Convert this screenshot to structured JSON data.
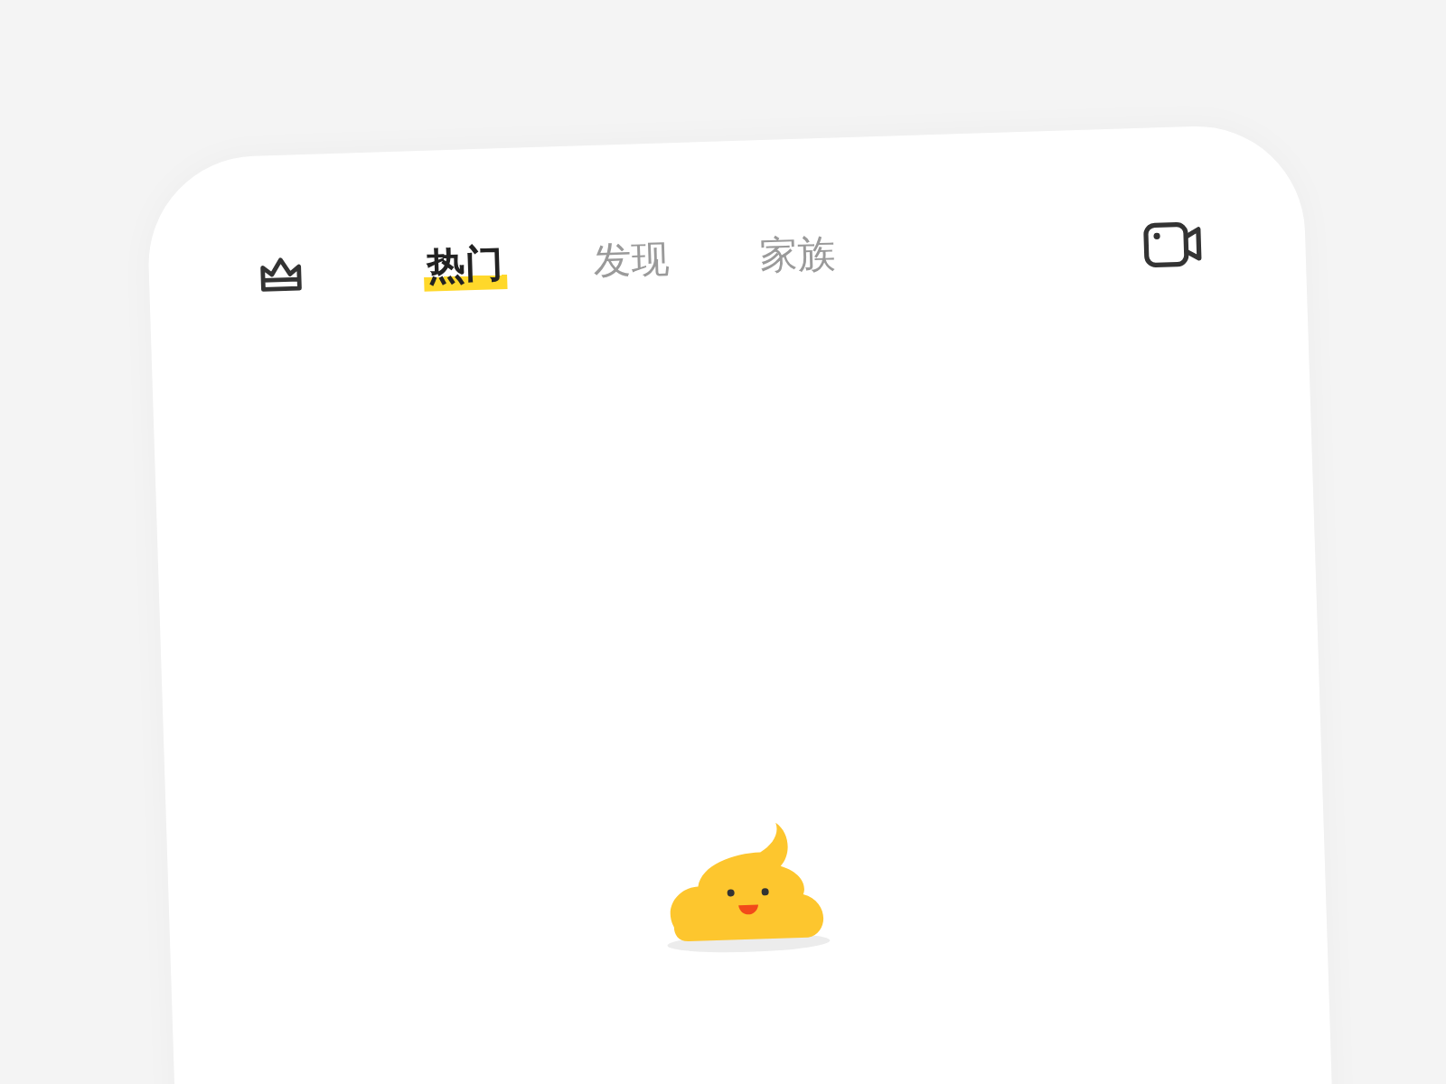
{
  "tabs": [
    {
      "label": "热门",
      "selected": true
    },
    {
      "label": "发现",
      "selected": false
    },
    {
      "label": "家族",
      "selected": false
    }
  ]
}
